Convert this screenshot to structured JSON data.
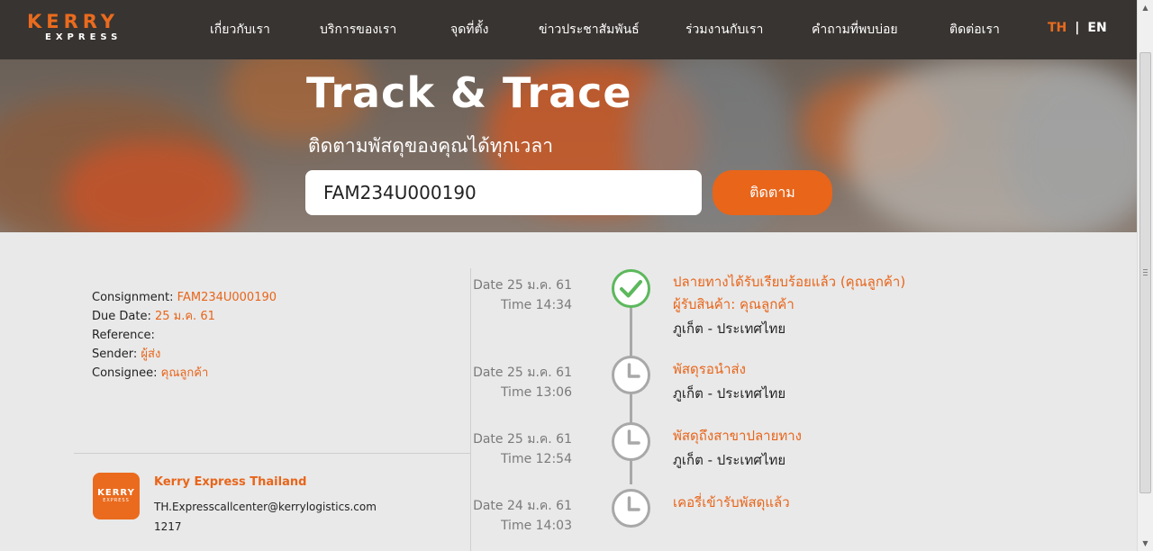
{
  "header": {
    "logo_main": "KERRY",
    "logo_sub": "EXPRESS",
    "nav": [
      "เกี่ยวกับเรา",
      "บริการของเรา",
      "จุดที่ตั้ง",
      "ข่าวประชาสัมพันธ์",
      "ร่วมงานกับเรา",
      "คำถามที่พบบ่อย",
      "ติดต่อเรา"
    ],
    "lang_th": "TH",
    "lang_sep": "|",
    "lang_en": "EN"
  },
  "hero": {
    "title": "Track & Trace",
    "subtitle": "ติดตามพัสดุของคุณได้ทุกเวลา",
    "search_value": "FAM234U000190",
    "button_label": "ติดตาม"
  },
  "shipment": {
    "consignment_label": "Consignment:",
    "consignment_value": "FAM234U000190",
    "due_label": "Due Date:",
    "due_value": "25 ม.ค. 61",
    "reference_label": "Reference:",
    "reference_value": "",
    "sender_label": "Sender:",
    "sender_value": "ผู้ส่ง",
    "consignee_label": "Consignee:",
    "consignee_value": "คุณลูกค้า"
  },
  "company": {
    "logo_main": "KERRY",
    "logo_sub": "EXPRESS",
    "name": "Kerry Express Thailand",
    "email": "TH.Expresscallcenter@kerrylogistics.com",
    "phone": "1217"
  },
  "timeline": [
    {
      "date": "Date 25 ม.ค. 61",
      "time": "Time 14:34",
      "icon": "check-circle-icon",
      "status": "ปลายทางได้รับเรียบร้อยแล้ว (คุณลูกค้า)",
      "receiver": "ผู้รับสินค้า: คุณลูกค้า",
      "location": "ภูเก็ต - ประเทศไทย"
    },
    {
      "date": "Date 25 ม.ค. 61",
      "time": "Time 13:06",
      "icon": "clock-icon",
      "status": "พัสดุรอนำส่ง",
      "location": "ภูเก็ต - ประเทศไทย"
    },
    {
      "date": "Date 25 ม.ค. 61",
      "time": "Time 12:54",
      "icon": "clock-icon",
      "status": "พัสดุถึงสาขาปลายทาง",
      "location": "ภูเก็ต - ประเทศไทย"
    },
    {
      "date": "Date 24 ม.ค. 61",
      "time": "Time 14:03",
      "icon": "clock-icon",
      "status": "เคอรี่เข้ารับพัสดุแล้ว"
    }
  ],
  "colors": {
    "accent": "#e8651a",
    "header_bg": "#383431",
    "success": "#5cb85c",
    "timeline_gray": "#a8a8a8"
  }
}
